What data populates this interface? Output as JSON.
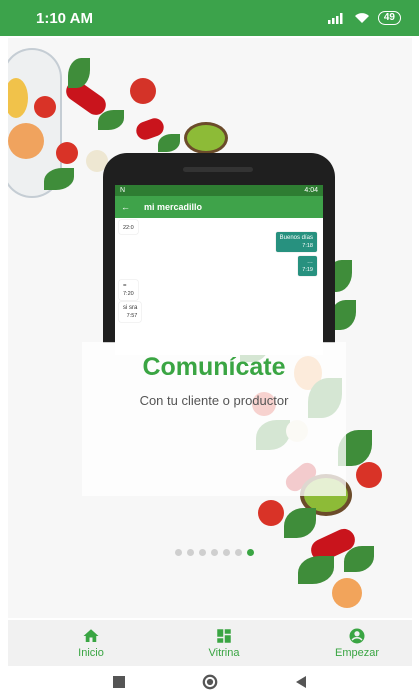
{
  "status_bar": {
    "time": "1:10 AM",
    "battery": "49"
  },
  "phone_screen": {
    "status_time": "4:04",
    "app_title": "mi mercadillo",
    "messages": [
      {
        "dir": "in",
        "text": "",
        "time": "22:0"
      },
      {
        "dir": "out",
        "text": "Buenos días",
        "time": "7:18"
      },
      {
        "dir": "out",
        "text": "…",
        "time": "7:19"
      },
      {
        "dir": "in",
        "text": "=",
        "time": "7:20"
      },
      {
        "dir": "in",
        "text": "si sra",
        "time": "7:57"
      }
    ]
  },
  "slide": {
    "headline": "Comunícate",
    "subline": "Con tu cliente o productor",
    "page_count": 7,
    "active_page": 7
  },
  "bottom_nav": [
    {
      "label": "Inicio",
      "icon": "home-icon"
    },
    {
      "label": "Vitrina",
      "icon": "dashboard-icon"
    },
    {
      "label": "Empezar",
      "icon": "account-icon"
    }
  ],
  "colors": {
    "accent": "#3aa543",
    "status_bar": "#3ca34b",
    "chat_out": "#27917f"
  }
}
